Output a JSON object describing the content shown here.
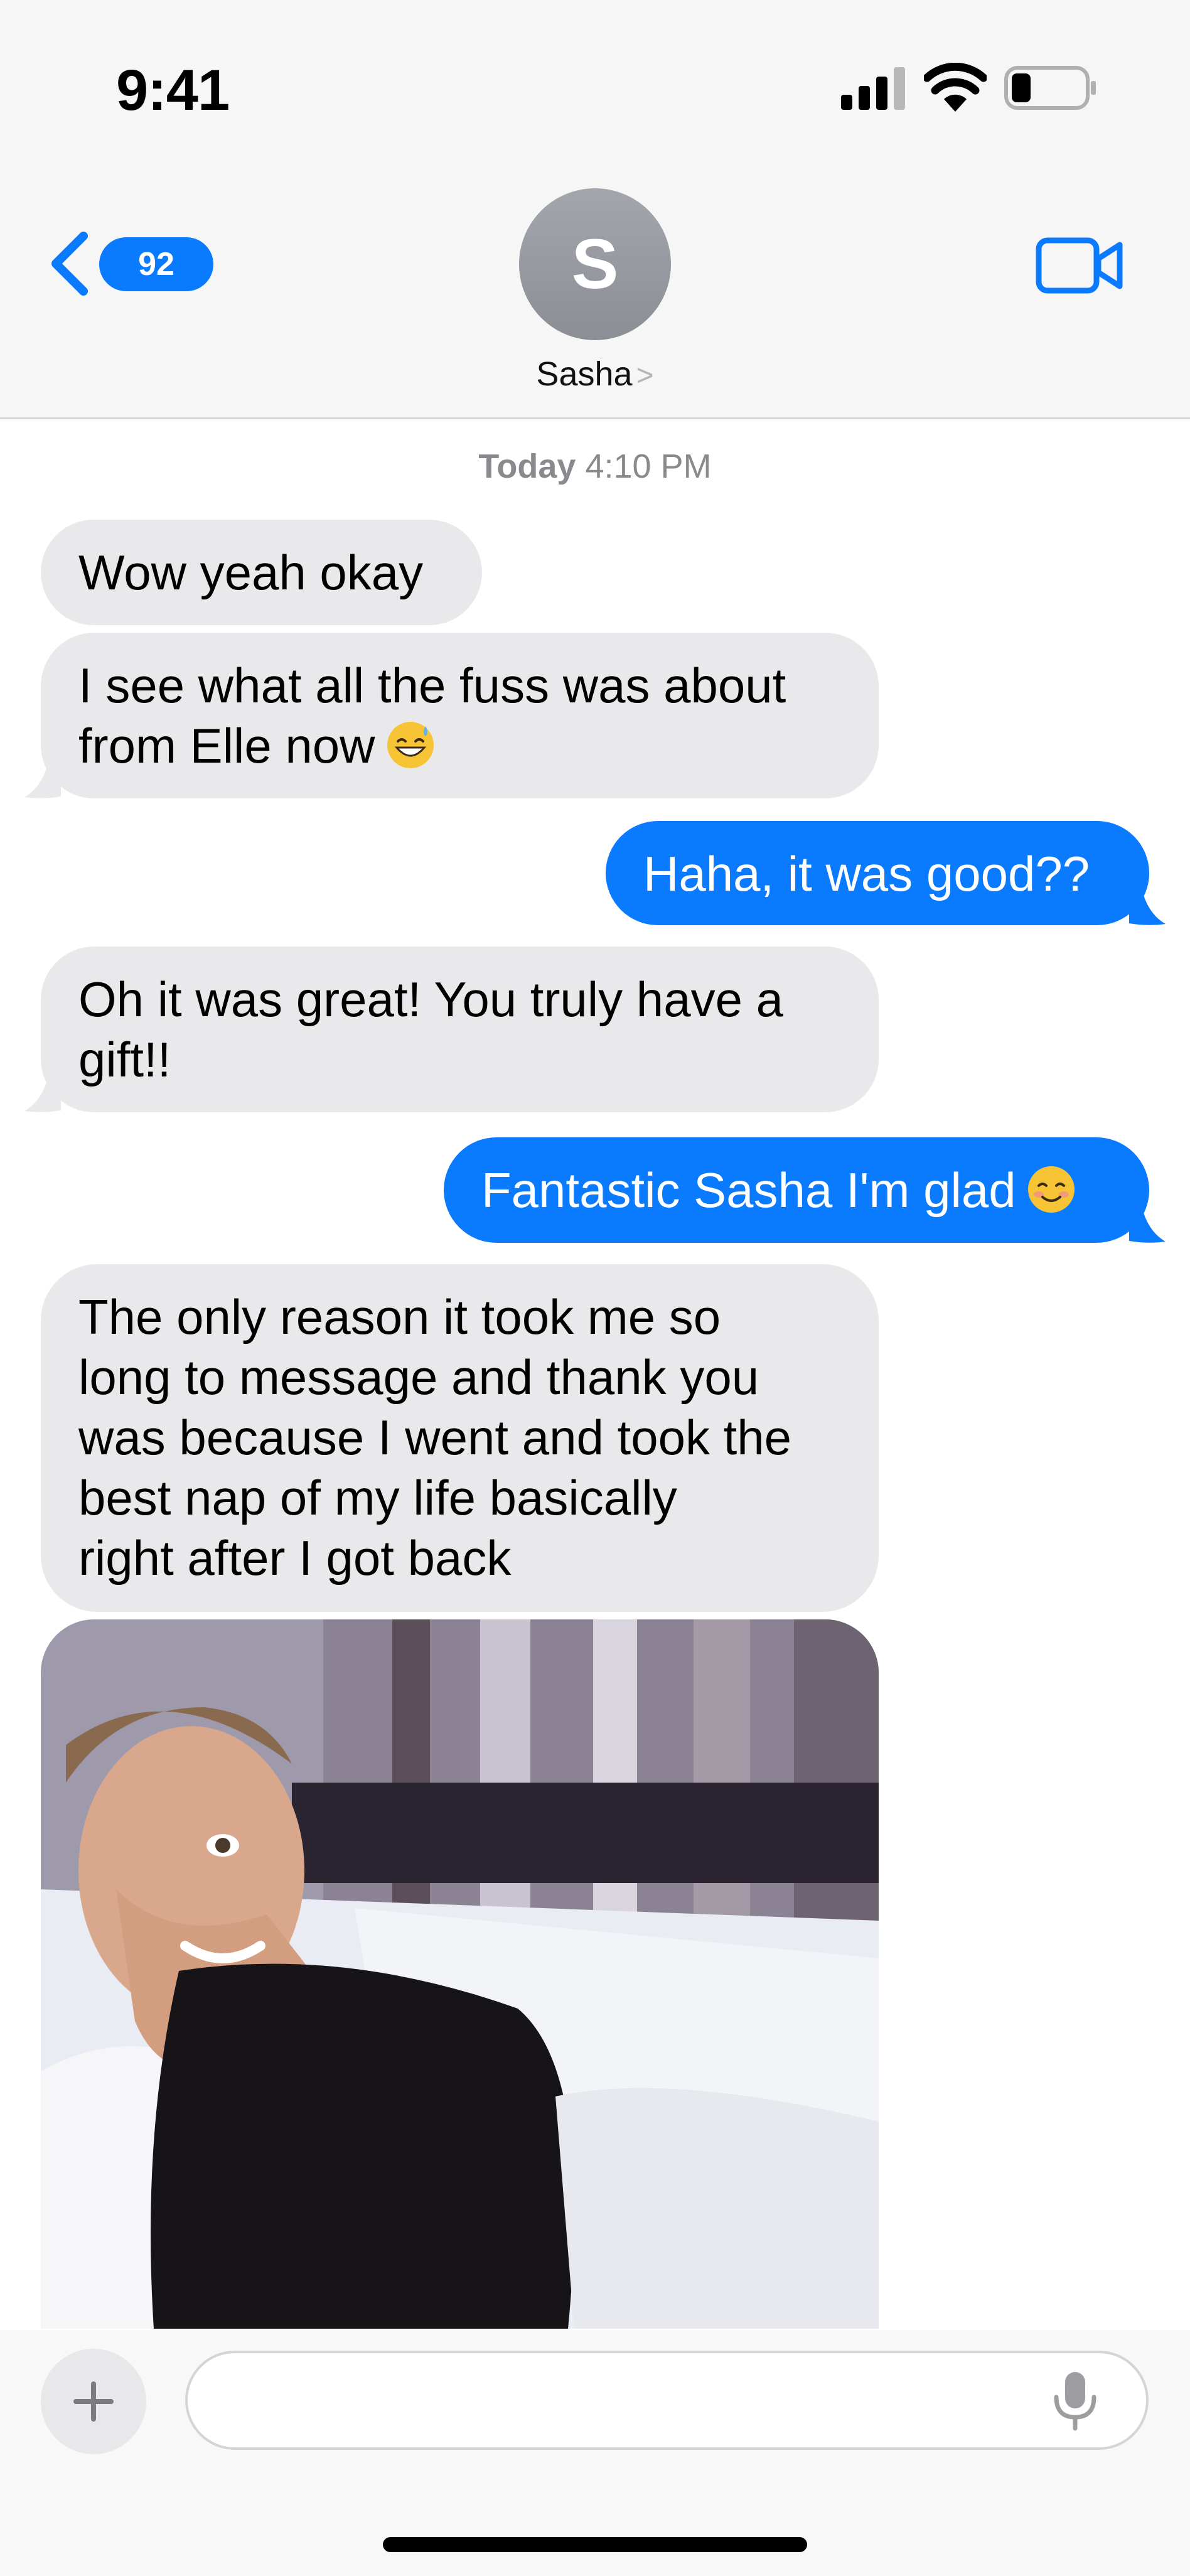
{
  "status_bar": {
    "time": "9:41"
  },
  "nav": {
    "back_badge": "92",
    "avatar_initial": "S",
    "contact_name": "Sasha",
    "contact_chevron": ">"
  },
  "conversation": {
    "timestamp_day": "Today",
    "timestamp_time": "4:10 PM",
    "messages": [
      {
        "from": "them",
        "lines": [
          "Wow yeah okay"
        ]
      },
      {
        "from": "them",
        "lines": [
          "I see what all the fuss was about",
          "from Elle now"
        ],
        "emoji": "grinning-sweat"
      },
      {
        "from": "me",
        "lines": [
          "Haha, it was good??"
        ]
      },
      {
        "from": "them",
        "lines": [
          "Oh it was great! You truly have a",
          "gift!!"
        ]
      },
      {
        "from": "me",
        "lines": [
          "Fantastic Sasha I'm glad"
        ],
        "emoji": "smiling-blush"
      },
      {
        "from": "them",
        "lines": [
          "The only reason it took me so",
          "long to message and thank you",
          "was because I went and took the",
          "best nap of my life basically",
          "right after I got back"
        ]
      },
      {
        "from": "them",
        "type": "photo"
      }
    ]
  },
  "composer": {
    "placeholder": ""
  },
  "colors": {
    "outgoing": "#0a7afe",
    "incoming": "#e9e9eb",
    "header_bg": "#f6f6f6"
  }
}
